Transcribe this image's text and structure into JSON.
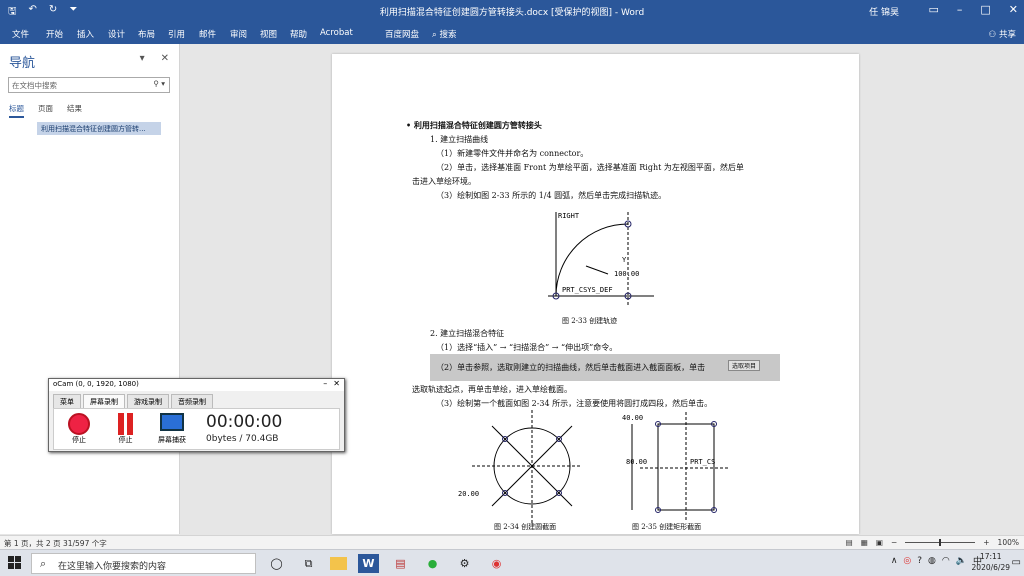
{
  "window": {
    "title": "利用扫描混合特征创建圆方管转接头.docx [受保护的视图] - Word",
    "user": "任 锦昊",
    "share": "共享"
  },
  "ribbon_tabs": [
    "文件",
    "开始",
    "插入",
    "设计",
    "布局",
    "引用",
    "邮件",
    "审阅",
    "视图",
    "帮助",
    "Acrobat",
    "百度网盘",
    "搜索"
  ],
  "nav": {
    "title": "导航",
    "search_placeholder": "在文档中搜索",
    "tabs": [
      "标题",
      "页面",
      "结果"
    ],
    "heading": "利用扫描混合特征创建圆方管转..."
  },
  "doc": {
    "heading": "• 利用扫描混合特征创建圆方管转接头",
    "lines": [
      "1. 建立扫描曲线",
      "（1）新建零件文件并命名为 connector。",
      "（2）单击，选择基准面 Front 为草绘平面，选择基准面 Right 为左视图平面，然后单",
      "击进入草绘环境。",
      "（3）绘制如图 2-33 所示的 1/4 圆弧，然后单击完成扫描轨迹。",
      "2. 建立扫描混合特征",
      "（1）选择“插入” → “扫描混合” → “伸出项”命令。",
      "（2）单击参照，选取刚建立的扫描曲线，然后单击截面进入截面面板，单击",
      "选取轨迹起点，再单击草绘，进入草绘截面。",
      "（3）绘制第一个截面如图 2-34 所示，注意要使用将圆打成四段，然后单击。"
    ],
    "highlight_btn": "选取项目",
    "fig33": {
      "caption": "图 2-33  创建轨迹",
      "right": "RIGHT",
      "y": "Y",
      "value": "100.00",
      "csys": "PRT_CSYS_DEF"
    },
    "fig34": {
      "caption": "图 2-34  创建圆截面",
      "value": "20.00"
    },
    "fig35": {
      "caption": "图 2-35  创建矩形截面",
      "top": "40.00",
      "side": "80.00",
      "csys": "PRT_CS"
    }
  },
  "status": {
    "left": "第 1 页，共 2 页    31/597 个字",
    "zoom": "100%"
  },
  "taskbar": {
    "search": "在这里输入你要搜索的内容",
    "ime": "中",
    "time": "17:11",
    "date": "2020/6/29"
  },
  "ocam": {
    "title": "oCam (0, 0, 1920, 1080)",
    "tabs": [
      "菜单",
      "屏幕录制",
      "游戏录制",
      "音频录制"
    ],
    "stop": "停止",
    "pause": "停止",
    "capture": "屏幕捕获",
    "timer": "00:00:00",
    "bytes": "0bytes / 70.4GB"
  }
}
